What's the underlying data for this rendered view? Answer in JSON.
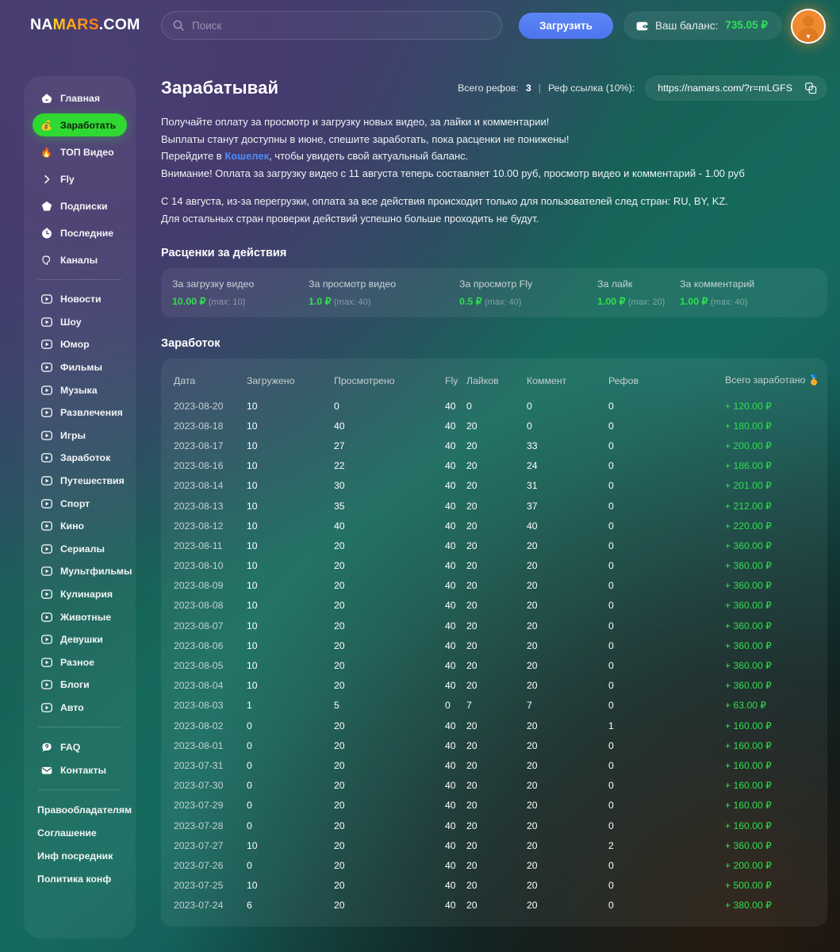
{
  "header": {
    "logo_part1": "NA",
    "logo_part2": "MARS",
    "logo_part3": ".COM",
    "search_placeholder": "Поиск",
    "search_value": "",
    "upload_label": "Загрузить",
    "balance_label": "Ваш баланс:",
    "balance_amount": "735.05 ₽"
  },
  "sidebar": {
    "top_items": [
      {
        "label": "Главная",
        "icon": "home-icon",
        "active": false
      },
      {
        "label": "Заработать",
        "icon": "money-bag-icon",
        "active": true
      },
      {
        "label": "ТОП Видео",
        "icon": "fire-icon",
        "active": false
      },
      {
        "label": "Fly",
        "icon": "chevron-right-icon",
        "active": false
      },
      {
        "label": "Подписки",
        "icon": "star-icon",
        "active": false
      },
      {
        "label": "Последние",
        "icon": "clock-icon",
        "active": false
      },
      {
        "label": "Каналы",
        "icon": "megaphone-icon",
        "active": false
      }
    ],
    "categories": [
      {
        "label": "Новости",
        "icon": "play-icon"
      },
      {
        "label": "Шоу",
        "icon": "play-icon"
      },
      {
        "label": "Юмор",
        "icon": "play-icon"
      },
      {
        "label": "Фильмы",
        "icon": "play-icon"
      },
      {
        "label": "Музыка",
        "icon": "play-icon"
      },
      {
        "label": "Развлечения",
        "icon": "play-icon"
      },
      {
        "label": "Игры",
        "icon": "play-icon"
      },
      {
        "label": "Заработок",
        "icon": "play-icon"
      },
      {
        "label": "Путешествия",
        "icon": "play-icon"
      },
      {
        "label": "Спорт",
        "icon": "play-icon"
      },
      {
        "label": "Кино",
        "icon": "play-icon"
      },
      {
        "label": "Сериалы",
        "icon": "play-icon"
      },
      {
        "label": "Мультфильмы",
        "icon": "play-icon"
      },
      {
        "label": "Кулинария",
        "icon": "play-icon"
      },
      {
        "label": "Животные",
        "icon": "play-icon"
      },
      {
        "label": "Девушки",
        "icon": "play-icon"
      },
      {
        "label": "Разное",
        "icon": "play-icon"
      },
      {
        "label": "Блоги",
        "icon": "play-icon"
      },
      {
        "label": "Авто",
        "icon": "play-icon"
      }
    ],
    "help_items": [
      {
        "label": "FAQ",
        "icon": "question-bubble-icon"
      },
      {
        "label": "Контакты",
        "icon": "envelope-icon"
      }
    ],
    "legal_items": [
      {
        "label": "Правообладателям"
      },
      {
        "label": "Соглашение"
      },
      {
        "label": "Инф посредник"
      },
      {
        "label": "Политика конф"
      }
    ]
  },
  "main": {
    "title": "Зарабатывай",
    "refs_label": "Всего рефов:",
    "refs_count": "3",
    "separator": "|",
    "reflink_label": "Реф ссылка (10%):",
    "reflink_url": "https://namars.com/?r=mLGFS",
    "intro_lines": [
      "Получайте оплату за просмотр и загрузку новых видео, за лайки и комментарии!",
      "Выплаты станут доступны в июне, спешите заработать, пока расценки не понижены!"
    ],
    "wallet_line_prefix": "Перейдите в ",
    "wallet_link": "Кошелек",
    "wallet_line_suffix": ", чтобы увидеть свой актуальный баланс.",
    "attention_line": "Внимание! Оплата за загрузку видео с 11 августа теперь составляет 10.00 руб, просмотр видео и комментарий - 1.00 руб",
    "country_line_1": "С 14 августа, из-за перегрузки, оплата за все действия происходит только для пользователей след стран: RU, BY, KZ.",
    "country_line_2": "Для остальных стран проверки действий успешно больше проходить не будут.",
    "rates_title": "Расценки за действия",
    "rates": [
      {
        "label": "За загрузку видео",
        "value": "10.00 ₽",
        "max": "(max: 10)"
      },
      {
        "label": "За просмотр видео",
        "value": "1.0 ₽",
        "max": "(max: 40)"
      },
      {
        "label": "За просмотр Fly",
        "value": "0.5 ₽",
        "max": "(max: 40)"
      },
      {
        "label": "За лайк",
        "value": "1.00 ₽",
        "max": "(max: 20)"
      },
      {
        "label": "За комментарий",
        "value": "1.00 ₽",
        "max": "(max: 40)"
      }
    ],
    "earnings_title": "Заработок",
    "table": {
      "columns": [
        "Дата",
        "Загружено",
        "Просмотрено",
        "Fly",
        "Лайков",
        "Коммент",
        "Рефов",
        "Всего заработано 🏅"
      ],
      "rows": [
        {
          "date": "2023-08-20",
          "uploaded": "10",
          "viewed": "0",
          "fly": "40",
          "likes": "0",
          "comments": "0",
          "refs": "0",
          "earned": "+ 120.00 ₽"
        },
        {
          "date": "2023-08-18",
          "uploaded": "10",
          "viewed": "40",
          "fly": "40",
          "likes": "20",
          "comments": "0",
          "refs": "0",
          "earned": "+ 180.00 ₽"
        },
        {
          "date": "2023-08-17",
          "uploaded": "10",
          "viewed": "27",
          "fly": "40",
          "likes": "20",
          "comments": "33",
          "refs": "0",
          "earned": "+ 200.00 ₽"
        },
        {
          "date": "2023-08-16",
          "uploaded": "10",
          "viewed": "22",
          "fly": "40",
          "likes": "20",
          "comments": "24",
          "refs": "0",
          "earned": "+ 186.00 ₽"
        },
        {
          "date": "2023-08-14",
          "uploaded": "10",
          "viewed": "30",
          "fly": "40",
          "likes": "20",
          "comments": "31",
          "refs": "0",
          "earned": "+ 201.00 ₽"
        },
        {
          "date": "2023-08-13",
          "uploaded": "10",
          "viewed": "35",
          "fly": "40",
          "likes": "20",
          "comments": "37",
          "refs": "0",
          "earned": "+ 212.00 ₽"
        },
        {
          "date": "2023-08-12",
          "uploaded": "10",
          "viewed": "40",
          "fly": "40",
          "likes": "20",
          "comments": "40",
          "refs": "0",
          "earned": "+ 220.00 ₽"
        },
        {
          "date": "2023-08-11",
          "uploaded": "10",
          "viewed": "20",
          "fly": "40",
          "likes": "20",
          "comments": "20",
          "refs": "0",
          "earned": "+ 360.00 ₽"
        },
        {
          "date": "2023-08-10",
          "uploaded": "10",
          "viewed": "20",
          "fly": "40",
          "likes": "20",
          "comments": "20",
          "refs": "0",
          "earned": "+ 360.00 ₽"
        },
        {
          "date": "2023-08-09",
          "uploaded": "10",
          "viewed": "20",
          "fly": "40",
          "likes": "20",
          "comments": "20",
          "refs": "0",
          "earned": "+ 360.00 ₽"
        },
        {
          "date": "2023-08-08",
          "uploaded": "10",
          "viewed": "20",
          "fly": "40",
          "likes": "20",
          "comments": "20",
          "refs": "0",
          "earned": "+ 360.00 ₽"
        },
        {
          "date": "2023-08-07",
          "uploaded": "10",
          "viewed": "20",
          "fly": "40",
          "likes": "20",
          "comments": "20",
          "refs": "0",
          "earned": "+ 360.00 ₽"
        },
        {
          "date": "2023-08-06",
          "uploaded": "10",
          "viewed": "20",
          "fly": "40",
          "likes": "20",
          "comments": "20",
          "refs": "0",
          "earned": "+ 360.00 ₽"
        },
        {
          "date": "2023-08-05",
          "uploaded": "10",
          "viewed": "20",
          "fly": "40",
          "likes": "20",
          "comments": "20",
          "refs": "0",
          "earned": "+ 360.00 ₽"
        },
        {
          "date": "2023-08-04",
          "uploaded": "10",
          "viewed": "20",
          "fly": "40",
          "likes": "20",
          "comments": "20",
          "refs": "0",
          "earned": "+ 360.00 ₽"
        },
        {
          "date": "2023-08-03",
          "uploaded": "1",
          "viewed": "5",
          "fly": "0",
          "likes": "7",
          "comments": "7",
          "refs": "0",
          "earned": "+ 63.00 ₽"
        },
        {
          "date": "2023-08-02",
          "uploaded": "0",
          "viewed": "20",
          "fly": "40",
          "likes": "20",
          "comments": "20",
          "refs": "1",
          "earned": "+ 160.00 ₽"
        },
        {
          "date": "2023-08-01",
          "uploaded": "0",
          "viewed": "20",
          "fly": "40",
          "likes": "20",
          "comments": "20",
          "refs": "0",
          "earned": "+ 160.00 ₽"
        },
        {
          "date": "2023-07-31",
          "uploaded": "0",
          "viewed": "20",
          "fly": "40",
          "likes": "20",
          "comments": "20",
          "refs": "0",
          "earned": "+ 160.00 ₽"
        },
        {
          "date": "2023-07-30",
          "uploaded": "0",
          "viewed": "20",
          "fly": "40",
          "likes": "20",
          "comments": "20",
          "refs": "0",
          "earned": "+ 160.00 ₽"
        },
        {
          "date": "2023-07-29",
          "uploaded": "0",
          "viewed": "20",
          "fly": "40",
          "likes": "20",
          "comments": "20",
          "refs": "0",
          "earned": "+ 160.00 ₽"
        },
        {
          "date": "2023-07-28",
          "uploaded": "0",
          "viewed": "20",
          "fly": "40",
          "likes": "20",
          "comments": "20",
          "refs": "0",
          "earned": "+ 160.00 ₽"
        },
        {
          "date": "2023-07-27",
          "uploaded": "10",
          "viewed": "20",
          "fly": "40",
          "likes": "20",
          "comments": "20",
          "refs": "2",
          "earned": "+ 360.00 ₽"
        },
        {
          "date": "2023-07-26",
          "uploaded": "0",
          "viewed": "20",
          "fly": "40",
          "likes": "20",
          "comments": "20",
          "refs": "0",
          "earned": "+ 200.00 ₽"
        },
        {
          "date": "2023-07-25",
          "uploaded": "10",
          "viewed": "20",
          "fly": "40",
          "likes": "20",
          "comments": "20",
          "refs": "0",
          "earned": "+ 500.00 ₽"
        },
        {
          "date": "2023-07-24",
          "uploaded": "6",
          "viewed": "20",
          "fly": "40",
          "likes": "20",
          "comments": "20",
          "refs": "0",
          "earned": "+ 380.00 ₽"
        }
      ]
    }
  },
  "colors": {
    "accent_green": "#2fd832",
    "earn_green": "#2fe04d",
    "upload_blue": "#5b86f5",
    "link_blue": "#4f8df5",
    "avatar_orange": "#f08a2e"
  }
}
